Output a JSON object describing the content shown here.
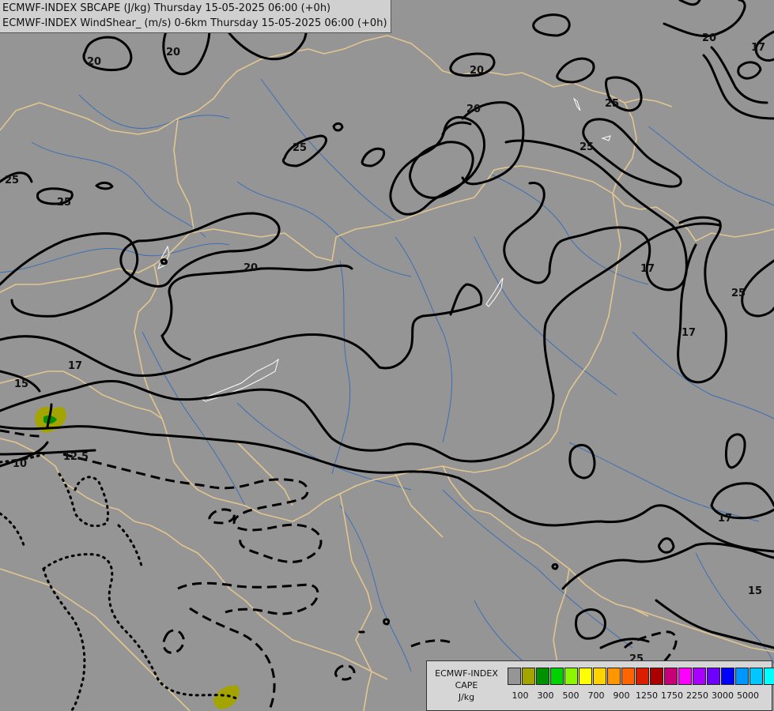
{
  "header": {
    "line1": "ECMWF-INDEX SBCAPE (J/kg) Thursday 15-05-2025 06:00 (+0h)",
    "line2": "ECMWF-INDEX WindShear_ (m/s) 0-6km Thursday 15-05-2025 06:00 (+0h)"
  },
  "map": {
    "background_color": "#959595",
    "border_color": "#e2c58f",
    "river_color": "#3c6fb3",
    "contour_color": "#000000",
    "contour_labels": [
      "20",
      "20",
      "20",
      "20",
      "20",
      "20",
      "17",
      "17",
      "25",
      "25",
      "25",
      "25",
      "25",
      "25",
      "17",
      "17",
      "17",
      "15",
      "15",
      "12.5",
      "10",
      "25"
    ]
  },
  "legend": {
    "title_lines": [
      "ECMWF-INDEX",
      "CAPE",
      "J/kg"
    ],
    "colors": [
      "#959595",
      "#a4a400",
      "#009100",
      "#00d200",
      "#8cf500",
      "#ffff00",
      "#ffd200",
      "#ff9600",
      "#ff6400",
      "#dc1e00",
      "#aa0000",
      "#c80078",
      "#ff00ff",
      "#aa00ff",
      "#6e00ff",
      "#0000ff",
      "#0096ff",
      "#00c8ff",
      "#00ffff",
      "#ffffff"
    ],
    "tick_labels": [
      "100",
      "300",
      "500",
      "700",
      "900",
      "1250",
      "1750",
      "2250",
      "3000",
      "5000"
    ]
  }
}
